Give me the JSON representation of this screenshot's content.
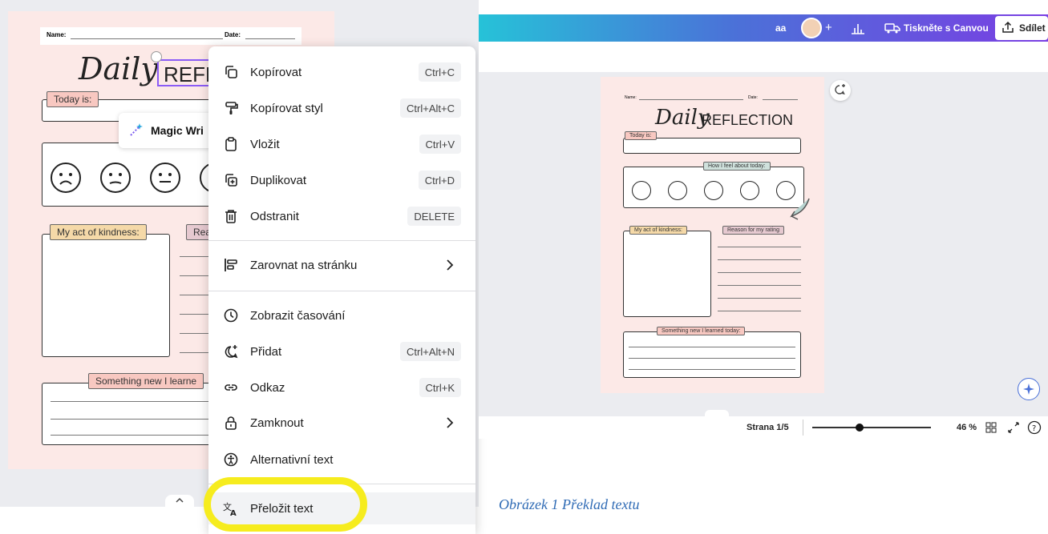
{
  "left_sheet": {
    "name_label": "Name:",
    "date_label": "Date:",
    "title_script": "Daily",
    "title_caps": "REFLE",
    "today_label": "Today is:",
    "kindness_label": "My act of kindness:",
    "reason_label_partial": "Rea",
    "learned_label_partial": "Something new I learne"
  },
  "magic_write": {
    "label": "Magic Wri",
    "icon": "magic-wand-icon"
  },
  "context_menu": {
    "items": [
      {
        "label": "Kopírovat",
        "shortcut": "Ctrl+C",
        "icon": "copy-icon"
      },
      {
        "label": "Kopírovat styl",
        "shortcut": "Ctrl+Alt+C",
        "icon": "paint-roller-icon"
      },
      {
        "label": "Vložit",
        "shortcut": "Ctrl+V",
        "icon": "clipboard-icon"
      },
      {
        "label": "Duplikovat",
        "shortcut": "Ctrl+D",
        "icon": "duplicate-icon"
      },
      {
        "label": "Odstranit",
        "shortcut": "DELETE",
        "icon": "trash-icon"
      },
      {
        "label": "Zarovnat na stránku",
        "icon": "align-icon"
      },
      {
        "label": "Zobrazit časování",
        "icon": "clock-icon"
      },
      {
        "label": "Přidat",
        "shortcut": "Ctrl+Alt+N",
        "icon": "add-comment-icon"
      },
      {
        "label": "Odkaz",
        "shortcut": "Ctrl+K",
        "icon": "link-icon"
      },
      {
        "label": "Zamknout",
        "icon": "lock-icon"
      },
      {
        "label": "Alternativní text",
        "icon": "accessibility-icon"
      },
      {
        "label": "Přeložit text",
        "icon": "translate-icon"
      }
    ]
  },
  "topbar": {
    "user_initials": "aa",
    "add_symbol": "+",
    "print_label": "Tiskněte s Canvou",
    "share_label": "Sdílet"
  },
  "right_sheet": {
    "name_label": "Name:",
    "date_label": "Date:",
    "title_script": "Daily",
    "title_caps": "REFLECTION",
    "today_label": "Today is:",
    "feel_label": "How I feel about today:",
    "kindness_label": "My act of kindness:",
    "reason_label": "Reason for my rating",
    "learned_label": "Something new I learned today:"
  },
  "bottombar": {
    "page_label": "Strana 1/5",
    "zoom_label": "46 %",
    "zoom_value_percent": 46
  },
  "caption": "Obrázek 1 Překlad textu",
  "colors": {
    "highlight": "#f6ec1e",
    "sheet_bg": "#fce9e7",
    "caption": "#2f6bb5"
  }
}
